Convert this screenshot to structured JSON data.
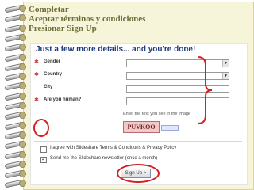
{
  "slide": {
    "lines": [
      "Completar",
      "Aceptar términos y condiciones",
      "Presionar Sign Up"
    ]
  },
  "form": {
    "title": "Just a few more details... and you're done!",
    "fields": [
      {
        "label": "Gender",
        "required": true,
        "type": "select"
      },
      {
        "label": "Country",
        "required": true,
        "type": "select"
      },
      {
        "label": "City",
        "required": false,
        "type": "text"
      },
      {
        "label": "Are you human?",
        "required": true,
        "type": "text"
      }
    ],
    "captcha_hint": "Enter the text you see in the image",
    "captcha_text": "PUVKOO",
    "agree_text": "I agree with Slideshare Terms & Conditions & Privacy Policy",
    "newsletter_text": "Send me the Slideshare newsletter (once a month)",
    "newsletter_checked": true,
    "signup_label": "Sign Up >"
  },
  "colors": {
    "annotation": "#d22020",
    "paper": "#f6f5da",
    "title_text": "#6e6e3c",
    "form_title": "#1f3b7a"
  }
}
